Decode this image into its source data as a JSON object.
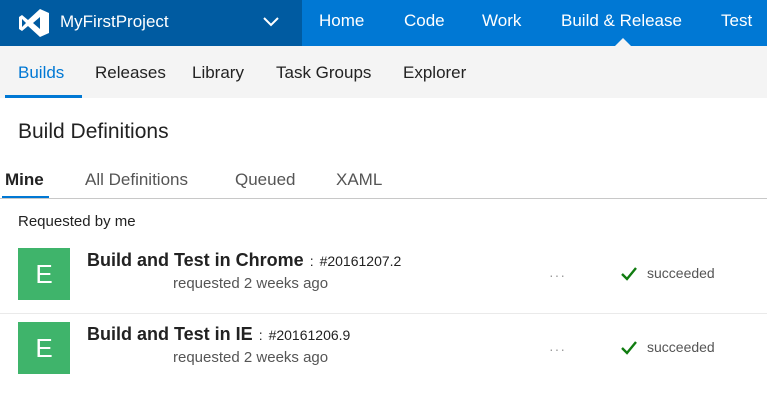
{
  "header": {
    "project_name": "MyFirstProject",
    "brand_color": "#0078d4",
    "project_bg_color": "#005ba1",
    "nav": [
      {
        "label": "Home"
      },
      {
        "label": "Code"
      },
      {
        "label": "Work"
      },
      {
        "label": "Build & Release",
        "active": true
      },
      {
        "label": "Test"
      }
    ]
  },
  "subnav": {
    "items": [
      {
        "label": "Builds",
        "active": true
      },
      {
        "label": "Releases"
      },
      {
        "label": "Library"
      },
      {
        "label": "Task Groups"
      },
      {
        "label": "Explorer"
      }
    ]
  },
  "page": {
    "title": "Build Definitions"
  },
  "tabs": [
    {
      "label": "Mine",
      "active": true
    },
    {
      "label": "All Definitions"
    },
    {
      "label": "Queued"
    },
    {
      "label": "XAML"
    }
  ],
  "section": {
    "header": "Requested by me"
  },
  "builds": [
    {
      "avatar_letter": "E",
      "avatar_color": "#3fb46b",
      "name": "Build and Test in Chrome",
      "separator": ":",
      "number": "#20161207.2",
      "requested": "requested 2 weeks ago",
      "more": "···",
      "status_icon": "check-icon",
      "status": "succeeded",
      "status_color": "#107c10"
    },
    {
      "avatar_letter": "E",
      "avatar_color": "#3fb46b",
      "name": "Build and Test in IE",
      "separator": ":",
      "number": "#20161206.9",
      "requested": "requested 2 weeks ago",
      "more": "···",
      "status_icon": "check-icon",
      "status": "succeeded",
      "status_color": "#107c10"
    }
  ]
}
